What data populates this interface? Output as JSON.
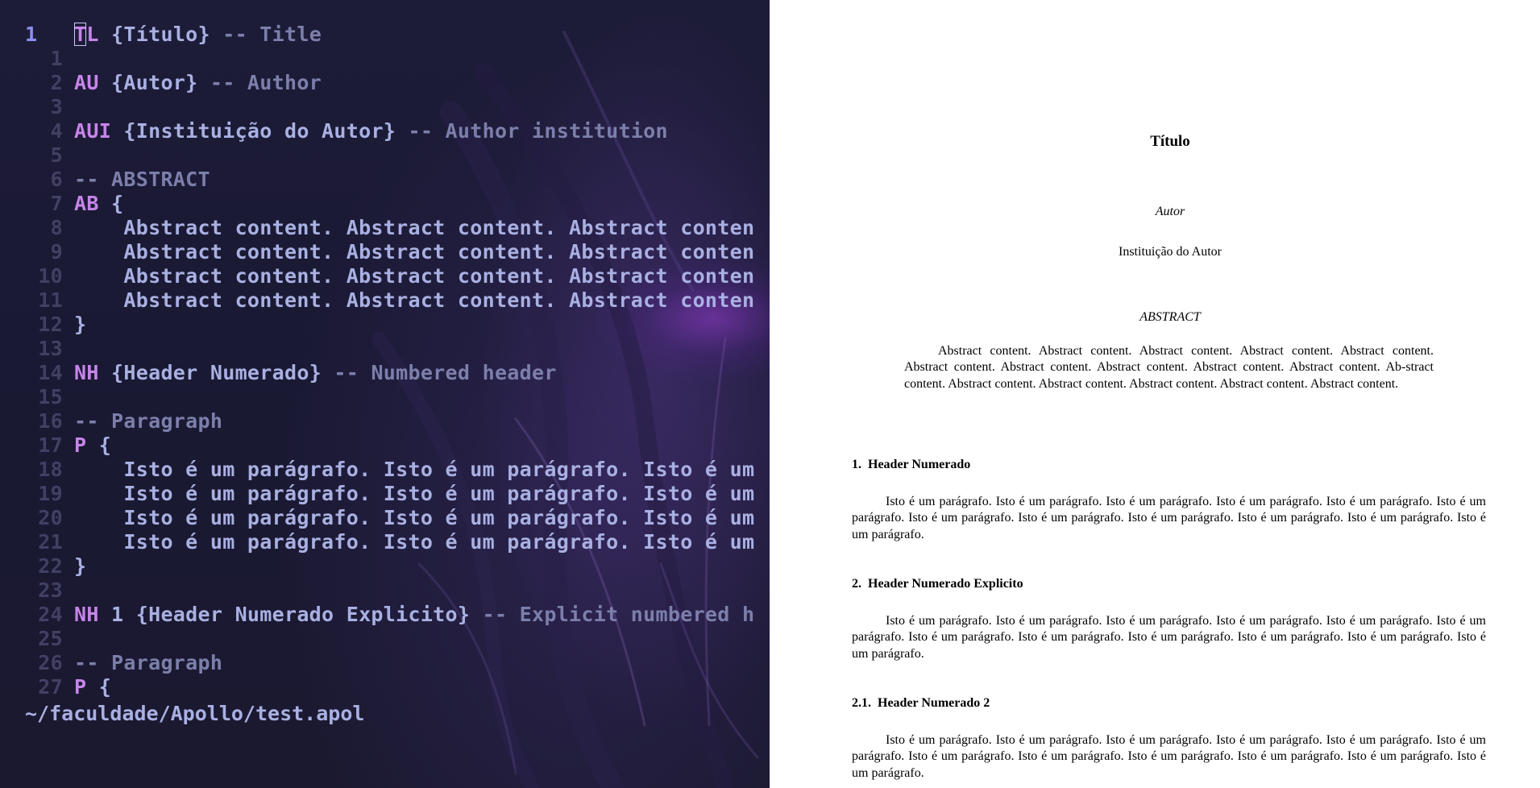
{
  "editor": {
    "current_line_number": "1",
    "cursor_char": "T",
    "lines": [
      {
        "num": "1",
        "parts": [
          {
            "t": "L",
            "c": "kw"
          },
          {
            "t": " {Título} ",
            "c": "plain"
          },
          {
            "t": "-- Title",
            "c": "cm"
          }
        ]
      },
      {
        "num": "1",
        "parts": []
      },
      {
        "num": "2",
        "parts": [
          {
            "t": "AU",
            "c": "kw"
          },
          {
            "t": " {Autor} ",
            "c": "plain"
          },
          {
            "t": "-- Author",
            "c": "cm"
          }
        ]
      },
      {
        "num": "3",
        "parts": []
      },
      {
        "num": "4",
        "parts": [
          {
            "t": "AUI",
            "c": "kw"
          },
          {
            "t": " {Instituição do Autor} ",
            "c": "plain"
          },
          {
            "t": "-- Author institution",
            "c": "cm"
          }
        ]
      },
      {
        "num": "5",
        "parts": []
      },
      {
        "num": "6",
        "parts": [
          {
            "t": "-- ABSTRACT",
            "c": "cm"
          }
        ]
      },
      {
        "num": "7",
        "parts": [
          {
            "t": "AB",
            "c": "kw"
          },
          {
            "t": " {",
            "c": "plain"
          }
        ]
      },
      {
        "num": "8",
        "parts": [
          {
            "t": "    Abstract content. Abstract content. Abstract conten",
            "c": "plain"
          }
        ]
      },
      {
        "num": "9",
        "parts": [
          {
            "t": "    Abstract content. Abstract content. Abstract conten",
            "c": "plain"
          }
        ]
      },
      {
        "num": "10",
        "parts": [
          {
            "t": "    Abstract content. Abstract content. Abstract conten",
            "c": "plain"
          }
        ]
      },
      {
        "num": "11",
        "parts": [
          {
            "t": "    Abstract content. Abstract content. Abstract conten",
            "c": "plain"
          }
        ]
      },
      {
        "num": "12",
        "parts": [
          {
            "t": "}",
            "c": "plain"
          }
        ]
      },
      {
        "num": "13",
        "parts": []
      },
      {
        "num": "14",
        "parts": [
          {
            "t": "NH",
            "c": "kw"
          },
          {
            "t": " {Header Numerado} ",
            "c": "plain"
          },
          {
            "t": "-- Numbered header",
            "c": "cm"
          }
        ]
      },
      {
        "num": "15",
        "parts": []
      },
      {
        "num": "16",
        "parts": [
          {
            "t": "-- Paragraph",
            "c": "cm"
          }
        ]
      },
      {
        "num": "17",
        "parts": [
          {
            "t": "P",
            "c": "kw"
          },
          {
            "t": " {",
            "c": "plain"
          }
        ]
      },
      {
        "num": "18",
        "parts": [
          {
            "t": "    Isto é um parágrafo. Isto é um parágrafo. Isto é um",
            "c": "plain"
          }
        ]
      },
      {
        "num": "19",
        "parts": [
          {
            "t": "    Isto é um parágrafo. Isto é um parágrafo. Isto é um",
            "c": "plain"
          }
        ]
      },
      {
        "num": "20",
        "parts": [
          {
            "t": "    Isto é um parágrafo. Isto é um parágrafo. Isto é um",
            "c": "plain"
          }
        ]
      },
      {
        "num": "21",
        "parts": [
          {
            "t": "    Isto é um parágrafo. Isto é um parágrafo. Isto é um",
            "c": "plain"
          }
        ]
      },
      {
        "num": "22",
        "parts": [
          {
            "t": "}",
            "c": "plain"
          }
        ]
      },
      {
        "num": "23",
        "parts": []
      },
      {
        "num": "24",
        "parts": [
          {
            "t": "NH",
            "c": "kw"
          },
          {
            "t": " 1 {Header Numerado Explicito} ",
            "c": "plain"
          },
          {
            "t": "-- Explicit numbered h",
            "c": "cm"
          }
        ]
      },
      {
        "num": "25",
        "parts": []
      },
      {
        "num": "26",
        "parts": [
          {
            "t": "-- Paragraph",
            "c": "cm"
          }
        ]
      },
      {
        "num": "27",
        "parts": [
          {
            "t": "P",
            "c": "kw"
          },
          {
            "t": " {",
            "c": "plain"
          }
        ]
      }
    ],
    "file_path": "~/faculdade/Apollo/test.apol"
  },
  "preview": {
    "title": "Título",
    "author": "Autor",
    "institution": "Instituição do Autor",
    "abstract_heading": "ABSTRACT",
    "abstract_text": "Abstract content. Abstract content. Abstract content. Abstract content.  Abstract content. Abstract content. Abstract content. Abstract content.  Abstract content. Abstract content. Ab-stract content. Abstract content.  Abstract content. Abstract content. Abstract content. Abstract content.",
    "sections": [
      {
        "heading": "1.  Header Numerado",
        "text": "Isto é um parágrafo. Isto é um parágrafo. Isto é um parágrafo.  Isto é um parágrafo. Isto é um parágrafo. Isto é um parágrafo.  Isto é um parágrafo. Isto é um parágrafo. Isto é um parágrafo.  Isto é um parágrafo. Isto é um parágrafo. Isto é um parágrafo."
      },
      {
        "heading": "2.  Header Numerado Explicito",
        "text": "Isto é um parágrafo. Isto é um parágrafo. Isto é um parágrafo.  Isto é um parágrafo. Isto é um parágrafo. Isto é um parágrafo.  Isto é um parágrafo. Isto é um parágrafo. Isto é um parágrafo.  Isto é um parágrafo. Isto é um parágrafo. Isto é um parágrafo."
      },
      {
        "heading": "2.1.  Header Numerado 2",
        "text": "Isto é um parágrafo. Isto é um parágrafo. Isto é um parágrafo.  Isto é um parágrafo. Isto é um parágrafo. Isto é um parágrafo.  Isto é um parágrafo. Isto é um parágrafo. Isto é um parágrafo.  Isto é um parágrafo. Isto é um parágrafo. Isto é um parágrafo."
      }
    ]
  }
}
